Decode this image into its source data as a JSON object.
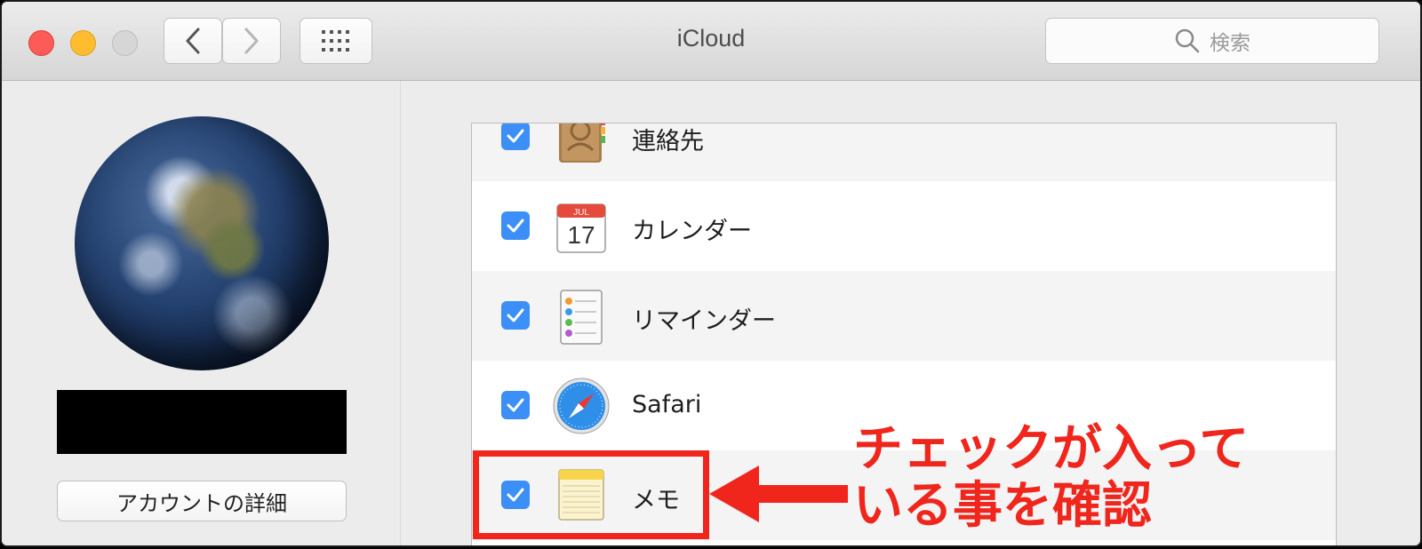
{
  "window": {
    "title": "iCloud"
  },
  "toolbar": {
    "back_label": "<",
    "forward_label": ">",
    "grid_label": "show all"
  },
  "search": {
    "placeholder": "検索"
  },
  "sidebar": {
    "account_button": "アカウントの詳細"
  },
  "services": [
    {
      "label": "連絡先",
      "checked": true,
      "icon": "contacts-icon"
    },
    {
      "label": "カレンダー",
      "checked": true,
      "icon": "calendar-icon",
      "icon_month": "JUL",
      "icon_day": "17"
    },
    {
      "label": "リマインダー",
      "checked": true,
      "icon": "reminders-icon"
    },
    {
      "label": "Safari",
      "checked": true,
      "icon": "safari-icon"
    },
    {
      "label": "メモ",
      "checked": true,
      "icon": "notes-icon"
    }
  ],
  "annotation": {
    "line1": "チェックが入って",
    "line2": "いる事を確認"
  },
  "colors": {
    "accent": "#3b8ff6",
    "annotation_red": "#f0261d"
  }
}
